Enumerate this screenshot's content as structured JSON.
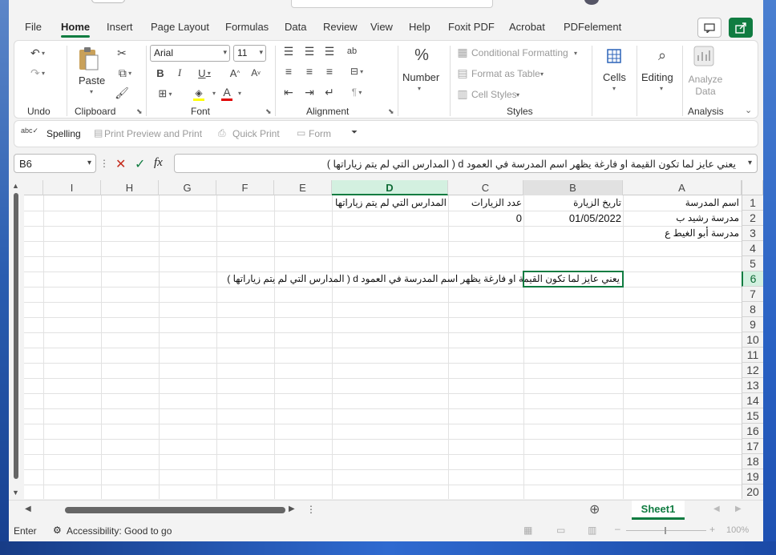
{
  "menu": {
    "tabs": [
      "File",
      "Home",
      "Insert",
      "Page Layout",
      "Formulas",
      "Data",
      "Review",
      "View",
      "Help",
      "Foxit PDF",
      "Acrobat",
      "PDFelement"
    ],
    "active": "Home"
  },
  "ribbon": {
    "undo_label": "Undo",
    "clipboard_label": "Clipboard",
    "paste_label": "Paste",
    "font_label": "Font",
    "font_name": "Arial",
    "font_size": "11",
    "alignment_label": "Alignment",
    "number_label": "Number",
    "number_symbol": "%",
    "styles_label": "Styles",
    "conditional_formatting": "Conditional Formatting",
    "format_as_table": "Format as Table",
    "cell_styles": "Cell Styles",
    "cells_label": "Cells",
    "editing_label": "Editing",
    "analyze_data_label": "Analyze Data",
    "analysis_label": "Analysis"
  },
  "quickbar": {
    "spelling": "Spelling",
    "print_preview": "Print Preview and Print",
    "quick_print": "Quick Print",
    "form": "Form"
  },
  "formula": {
    "namebox": "B6",
    "fx": "fx",
    "content": "يعني عايز لما تكون القيمة او فارغة  يظهر اسم المدرسة في العمود d ( المدارس التي لم يتم زياراتها )"
  },
  "grid": {
    "columns": [
      "I",
      "H",
      "G",
      "F",
      "E",
      "D",
      "C",
      "B",
      "A"
    ],
    "selected_column": "D",
    "active_column": "B",
    "rows": [
      "1",
      "2",
      "3",
      "4",
      "5",
      "6",
      "7",
      "8",
      "9",
      "10",
      "11",
      "12",
      "13",
      "14",
      "15",
      "16",
      "17",
      "18",
      "19",
      "20"
    ],
    "selected_row": "6",
    "cells": {
      "A1": "اسم المدرسة",
      "B1": "تاريخ الزيارة",
      "C1": "عدد الزيارات",
      "D1": "المدارس التي لم يتم زياراتها",
      "A2": "مدرسة رشيد ب",
      "B2": "01/05/2022",
      "C2": "0",
      "A3": "مدرسة أبو الغيط ع",
      "B6": "يعني عايز لما تكون القيمة او فارغة  يظهر اسم المدرسة في العمود d ( المدارس التي لم يتم زياراتها )"
    }
  },
  "sheets": {
    "tabs": [
      "Sheet1"
    ],
    "active": "Sheet1"
  },
  "status": {
    "mode": "Enter",
    "accessibility": "Accessibility: Good to go",
    "zoom": "100%"
  },
  "colors": {
    "accent": "#107c41",
    "selected_header_bg": "#d3f0e0",
    "font_color_bar": "#e00000",
    "highlight_bar": "#ffff00"
  }
}
